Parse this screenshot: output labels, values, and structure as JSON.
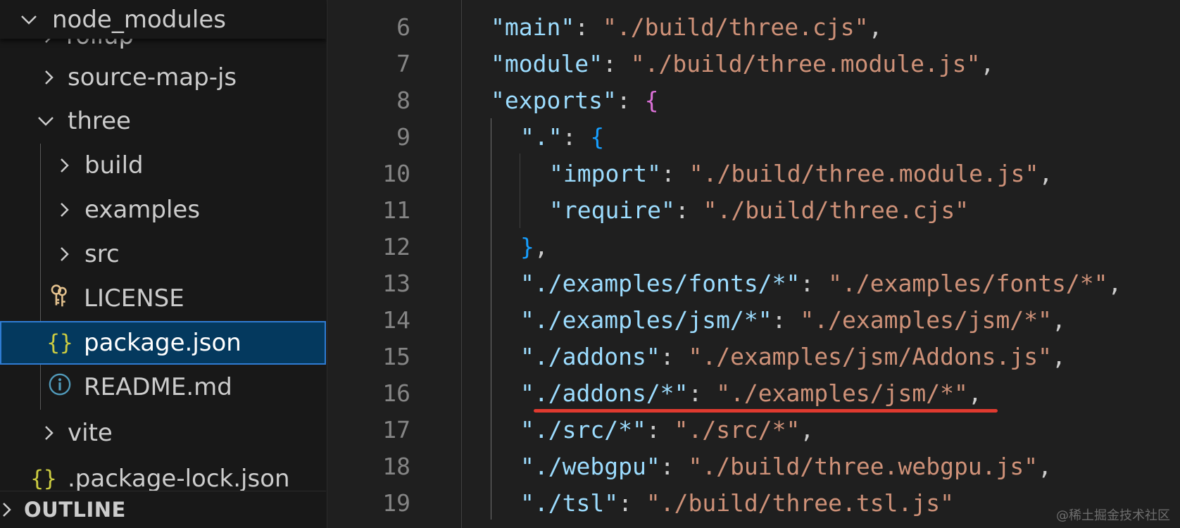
{
  "sidebar": {
    "header": {
      "label": "node_modules"
    },
    "items": [
      {
        "label": "rollup",
        "type": "folder",
        "expanded": false
      },
      {
        "label": "source-map-js",
        "type": "folder",
        "expanded": false
      },
      {
        "label": "three",
        "type": "folder",
        "expanded": true
      },
      {
        "label": "build",
        "type": "folder",
        "expanded": false
      },
      {
        "label": "examples",
        "type": "folder",
        "expanded": false
      },
      {
        "label": "src",
        "type": "folder",
        "expanded": false
      },
      {
        "label": "LICENSE",
        "type": "file",
        "icon": "key-icon"
      },
      {
        "label": "package.json",
        "type": "file",
        "icon": "braces-icon",
        "selected": true
      },
      {
        "label": "README.md",
        "type": "file",
        "icon": "info-icon"
      },
      {
        "label": "vite",
        "type": "folder",
        "expanded": false
      },
      {
        "label": ".package-lock.json",
        "type": "file",
        "icon": "braces-icon"
      }
    ],
    "outline": {
      "label": "OUTLINE"
    }
  },
  "editor": {
    "lines": [
      {
        "n": "6",
        "key": "main",
        "value": "./build/three.cjs",
        "trail": ","
      },
      {
        "n": "7",
        "key": "module",
        "value": "./build/three.module.js",
        "trail": ","
      },
      {
        "n": "8",
        "key": "exports",
        "open": "{"
      },
      {
        "n": "9",
        "key": ".",
        "open": "{"
      },
      {
        "n": "10",
        "key": "import",
        "value": "./build/three.module.js",
        "trail": ","
      },
      {
        "n": "11",
        "key": "require",
        "value": "./build/three.cjs",
        "trail": ""
      },
      {
        "n": "12",
        "close": "}",
        "trail": ","
      },
      {
        "n": "13",
        "key": "./examples/fonts/*",
        "value": "./examples/fonts/*",
        "trail": ","
      },
      {
        "n": "14",
        "key": "./examples/jsm/*",
        "value": "./examples/jsm/*",
        "trail": ","
      },
      {
        "n": "15",
        "key": "./addons",
        "value": "./examples/jsm/Addons.js",
        "trail": ","
      },
      {
        "n": "16",
        "key": "./addons/*",
        "value": "./examples/jsm/*",
        "trail": ",",
        "highlighted": true
      },
      {
        "n": "17",
        "key": "./src/*",
        "value": "./src/*",
        "trail": ","
      },
      {
        "n": "18",
        "key": "./webgpu",
        "value": "./build/three.webgpu.js",
        "trail": ","
      },
      {
        "n": "19",
        "key": "./tsl",
        "value": "./build/three.tsl.js",
        "trail": ""
      }
    ],
    "colors": {
      "key": "#9cdcfe",
      "string": "#ce9178",
      "bracket1": "#da70d6",
      "bracket2": "#179fff",
      "underline": "#e03a2f"
    }
  },
  "watermark": "@稀土掘金技术社区"
}
